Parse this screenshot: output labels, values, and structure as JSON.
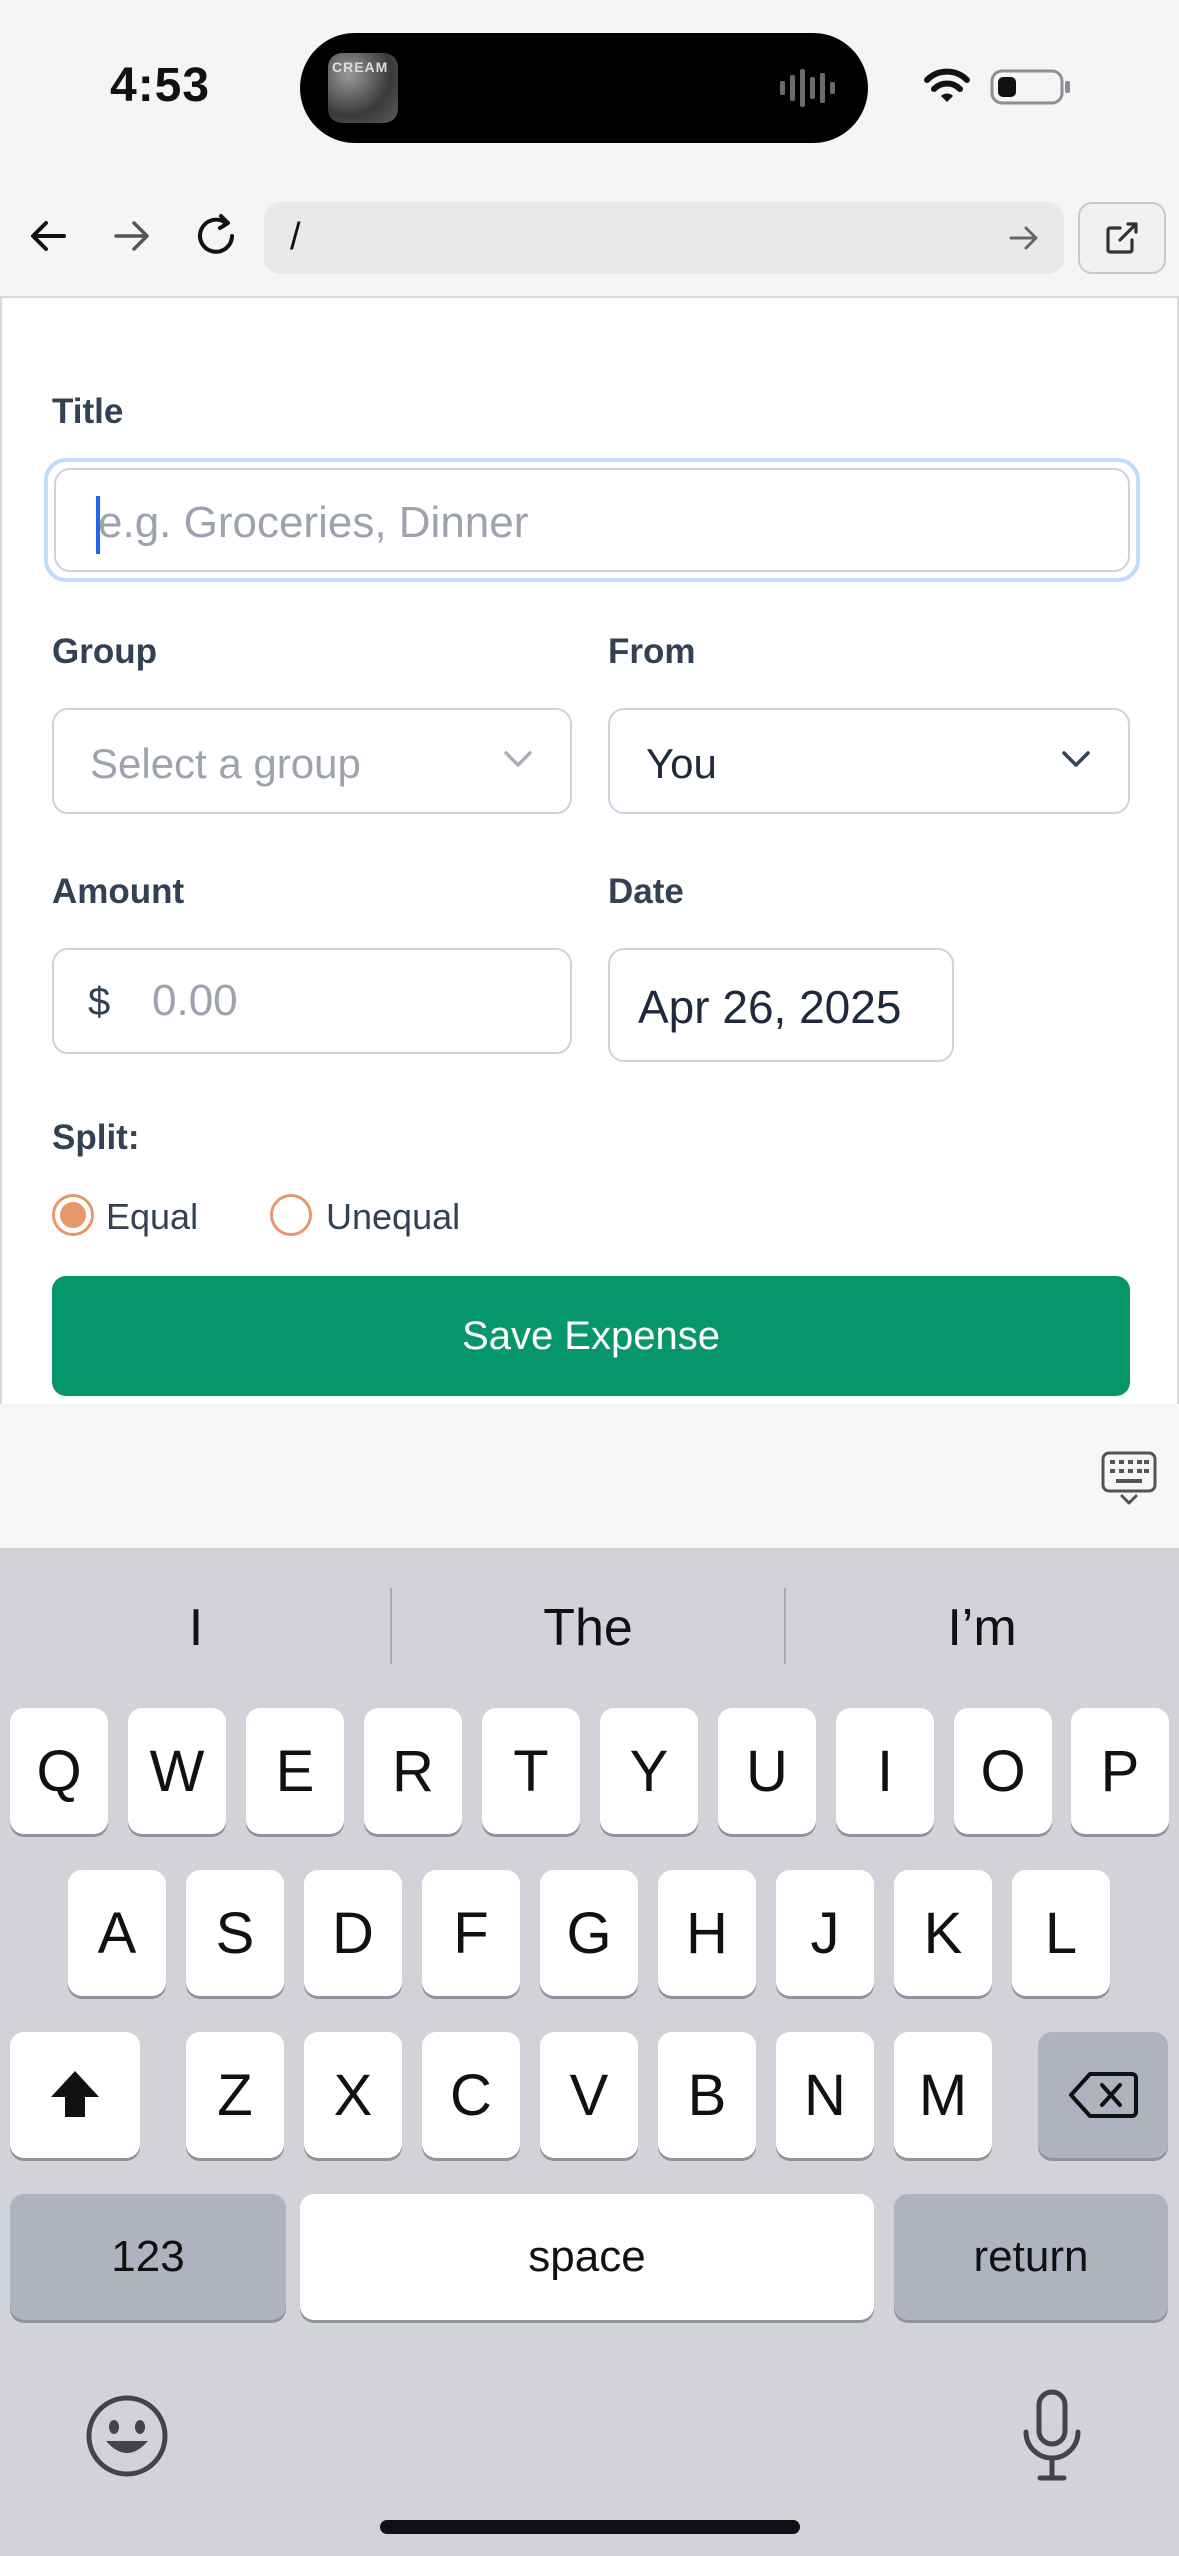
{
  "status": {
    "time": "4:53",
    "island_thumb_text": "CREAM"
  },
  "browser": {
    "url": "/",
    "icons": {
      "back": "arrow-left-icon",
      "forward": "arrow-right-icon",
      "reload": "reload-icon",
      "go": "arrow-right-icon",
      "open_external": "external-link-icon"
    }
  },
  "form": {
    "title_label": "Title",
    "title_placeholder": "e.g. Groceries, Dinner",
    "group_label": "Group",
    "group_placeholder": "Select a group",
    "from_label": "From",
    "from_value": "You",
    "amount_label": "Amount",
    "amount_currency": "$",
    "amount_placeholder": "0.00",
    "date_label": "Date",
    "date_value": "Apr 26, 2025",
    "split_label": "Split:",
    "split_options": [
      {
        "label": "Equal",
        "selected": true
      },
      {
        "label": "Unequal",
        "selected": false
      }
    ],
    "save_label": "Save Expense",
    "colors": {
      "save_button": "#059669",
      "radio_accent": "#e8976b",
      "focus_ring": "#bfdbfe"
    }
  },
  "keyboard": {
    "suggestions": [
      "I",
      "The",
      "I’m"
    ],
    "row1": [
      "Q",
      "W",
      "E",
      "R",
      "T",
      "Y",
      "U",
      "I",
      "O",
      "P"
    ],
    "row2": [
      "A",
      "S",
      "D",
      "F",
      "G",
      "H",
      "J",
      "K",
      "L"
    ],
    "row3": [
      "Z",
      "X",
      "C",
      "V",
      "B",
      "N",
      "M"
    ],
    "numbers_label": "123",
    "space_label": "space",
    "return_label": "return"
  }
}
